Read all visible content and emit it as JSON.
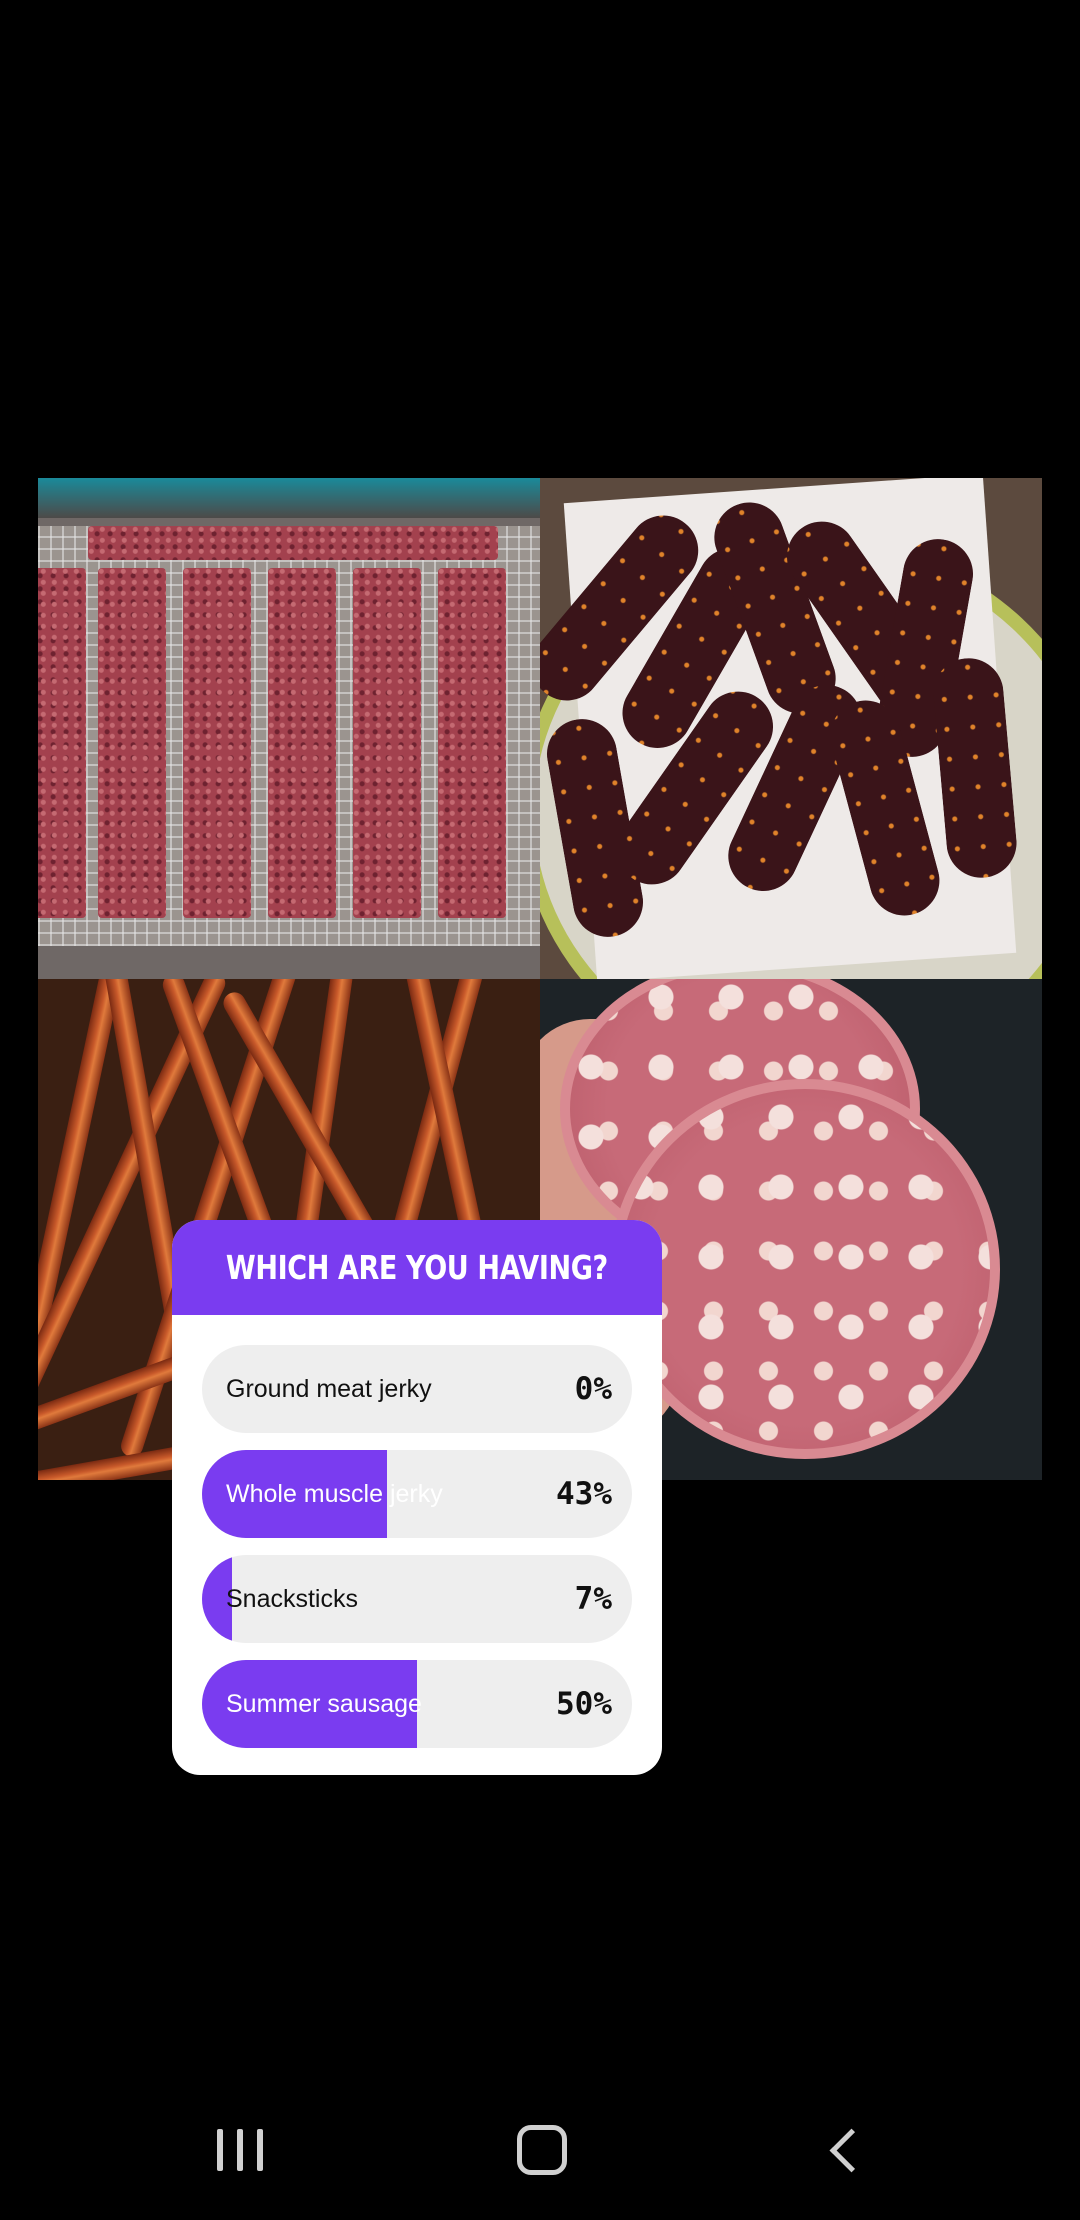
{
  "poll": {
    "title": "WHICH ARE YOU HAVING?",
    "options": [
      {
        "label": "Ground meat jerky",
        "percent_text": "0%",
        "percent": 0
      },
      {
        "label": "Whole muscle jerky",
        "percent_text": "43%",
        "percent": 43
      },
      {
        "label": "Snacksticks",
        "percent_text": "7%",
        "percent": 7
      },
      {
        "label": "Summer sausage",
        "percent_text": "50%",
        "percent": 50
      }
    ]
  },
  "collage": {
    "images": [
      {
        "icon": "ground-meat-jerky-photo"
      },
      {
        "icon": "whole-muscle-jerky-photo"
      },
      {
        "icon": "snacksticks-photo"
      },
      {
        "icon": "summer-sausage-photo"
      }
    ]
  },
  "colors": {
    "accent": "#7a3cf0",
    "option_bg": "#eeeeee",
    "background": "#000000"
  },
  "navbar": {
    "icons": [
      "recents-icon",
      "home-icon",
      "back-icon"
    ]
  }
}
